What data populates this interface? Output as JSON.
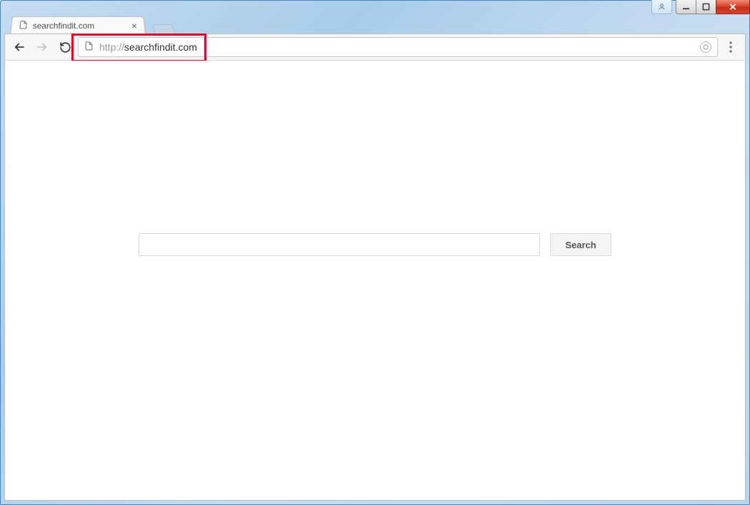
{
  "window": {
    "controls": {
      "user": "user",
      "minimize": "minimize",
      "maximize": "maximize",
      "close": "close"
    }
  },
  "tab": {
    "title": "searchfindit.com"
  },
  "toolbar": {
    "back": "Back",
    "forward": "Forward",
    "reload": "Reload",
    "menu": "Menu"
  },
  "address": {
    "scheme": "http://",
    "host": "searchfindit.com"
  },
  "page": {
    "search_placeholder": "",
    "search_value": "",
    "search_button": "Search"
  },
  "annotation": {
    "highlight_target": "address-bar"
  }
}
